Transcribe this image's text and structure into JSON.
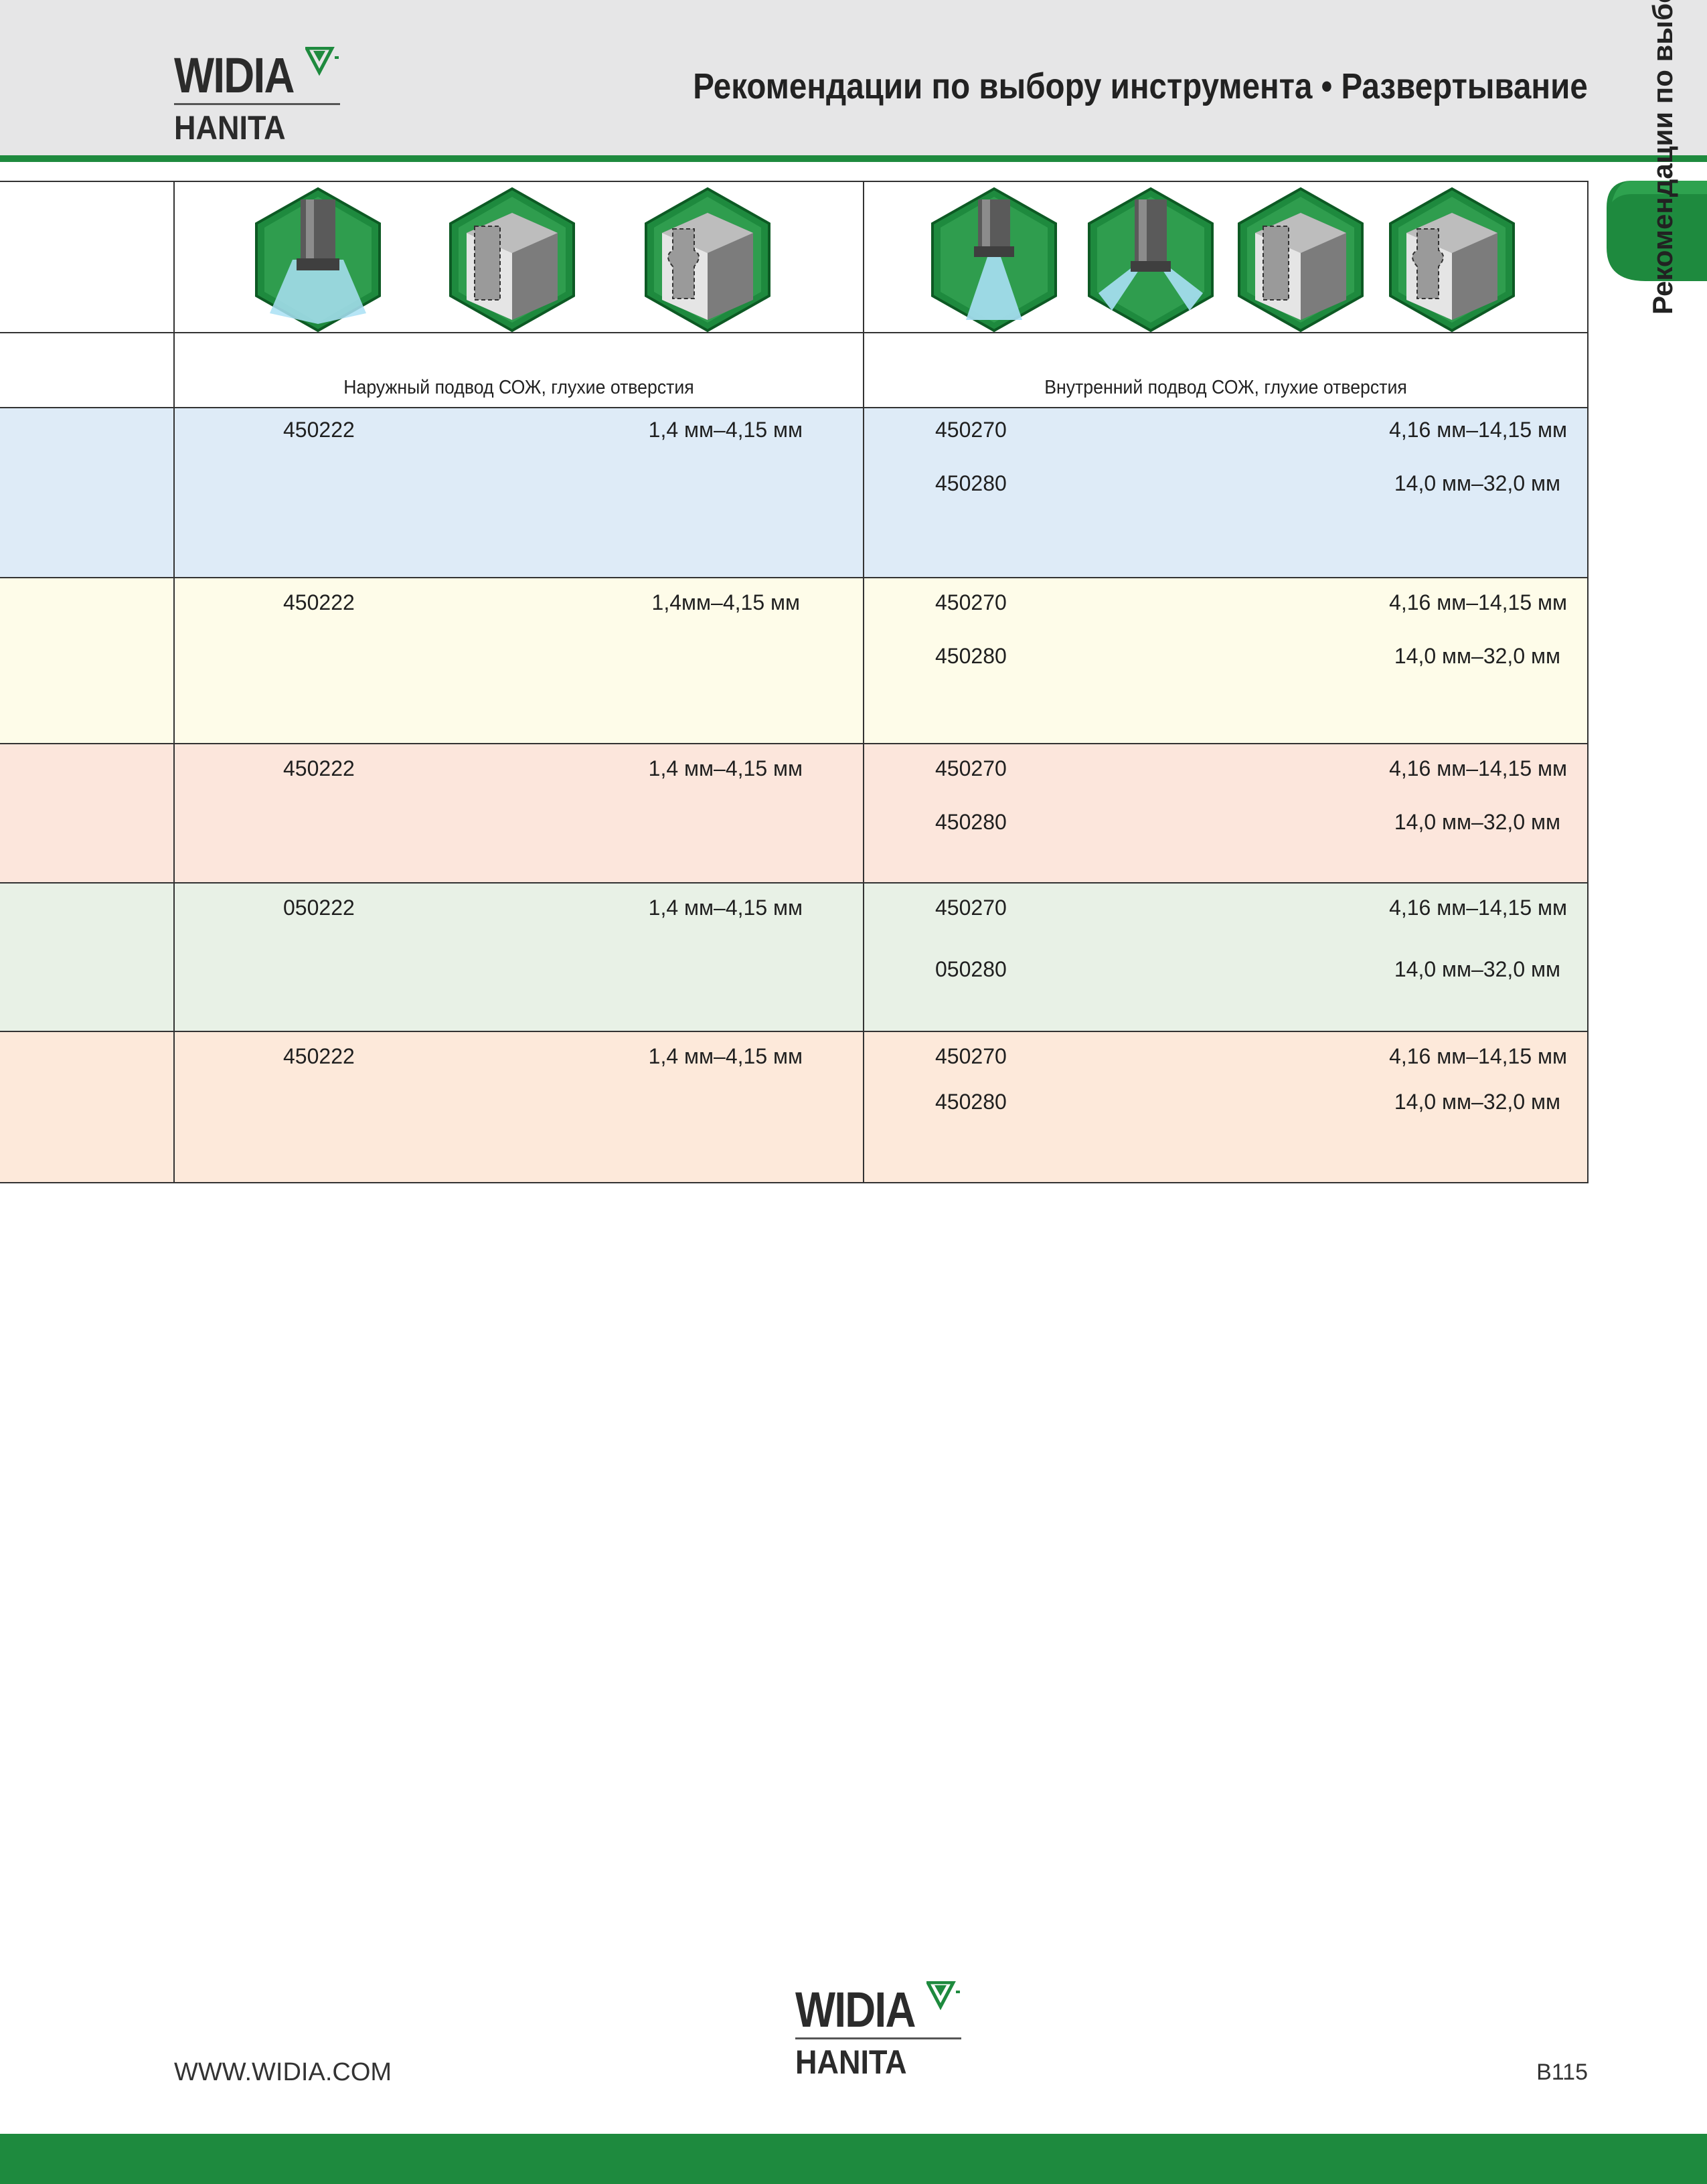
{
  "header": {
    "logo_top": "WIDIA",
    "logo_bottom": "HANITA",
    "title": "Рекомендации по выбору инструмента • Развертывание"
  },
  "side_tab": {
    "label": "Рекомендации по выбору инструмента"
  },
  "table": {
    "left_caption": "Наружный подвод СОЖ, глухие отверстия",
    "right_caption": "Внутренний подвод СОЖ, глухие отверстия",
    "rows": [
      {
        "left": {
          "code": "450222",
          "range": "1,4 мм–4,15 мм"
        },
        "right": [
          {
            "code": "450270",
            "range": "4,16 мм–14,15 мм"
          },
          {
            "code": "450280",
            "range": "14,0 мм–32,0 мм"
          }
        ]
      },
      {
        "left": {
          "code": "450222",
          "range": "1,4мм–4,15 мм"
        },
        "right": [
          {
            "code": "450270",
            "range": "4,16 мм–14,15 мм"
          },
          {
            "code": "450280",
            "range": "14,0 мм–32,0 мм"
          }
        ]
      },
      {
        "left": {
          "code": "450222",
          "range": "1,4 мм–4,15 мм"
        },
        "right": [
          {
            "code": "450270",
            "range": "4,16 мм–14,15 мм"
          },
          {
            "code": "450280",
            "range": "14,0 мм–32,0 мм"
          }
        ]
      },
      {
        "left": {
          "code": "050222",
          "range": "1,4 мм–4,15 мм"
        },
        "right": [
          {
            "code": "450270",
            "range": "4,16 мм–14,15 мм"
          },
          {
            "code": "050280",
            "range": "14,0 мм–32,0 мм"
          }
        ]
      },
      {
        "left": {
          "code": "450222",
          "range": "1,4 мм–4,15 мм"
        },
        "right": [
          {
            "code": "450270",
            "range": "4,16 мм–14,15 мм"
          },
          {
            "code": "450280",
            "range": "14,0 мм–32,0 мм"
          }
        ]
      }
    ]
  },
  "icons": {
    "left": [
      "external-coolant-reamer-icon",
      "blind-hole-icon",
      "stepped-blind-hole-icon"
    ],
    "right": [
      "internal-coolant-reamer-icon",
      "internal-coolant-side-jets-icon",
      "blind-hole-icon",
      "stepped-blind-hole-icon"
    ]
  },
  "footer": {
    "url": "WWW.WIDIA.COM",
    "logo_top": "WIDIA",
    "logo_bottom": "HANITA",
    "page_number": "B115"
  },
  "colors": {
    "brand_green": "#1e8a3e",
    "row1": "#deebf7",
    "row2": "#fefce9",
    "row3": "#fce6dc",
    "row4": "#e8f1e6",
    "row5": "#fde9da"
  }
}
